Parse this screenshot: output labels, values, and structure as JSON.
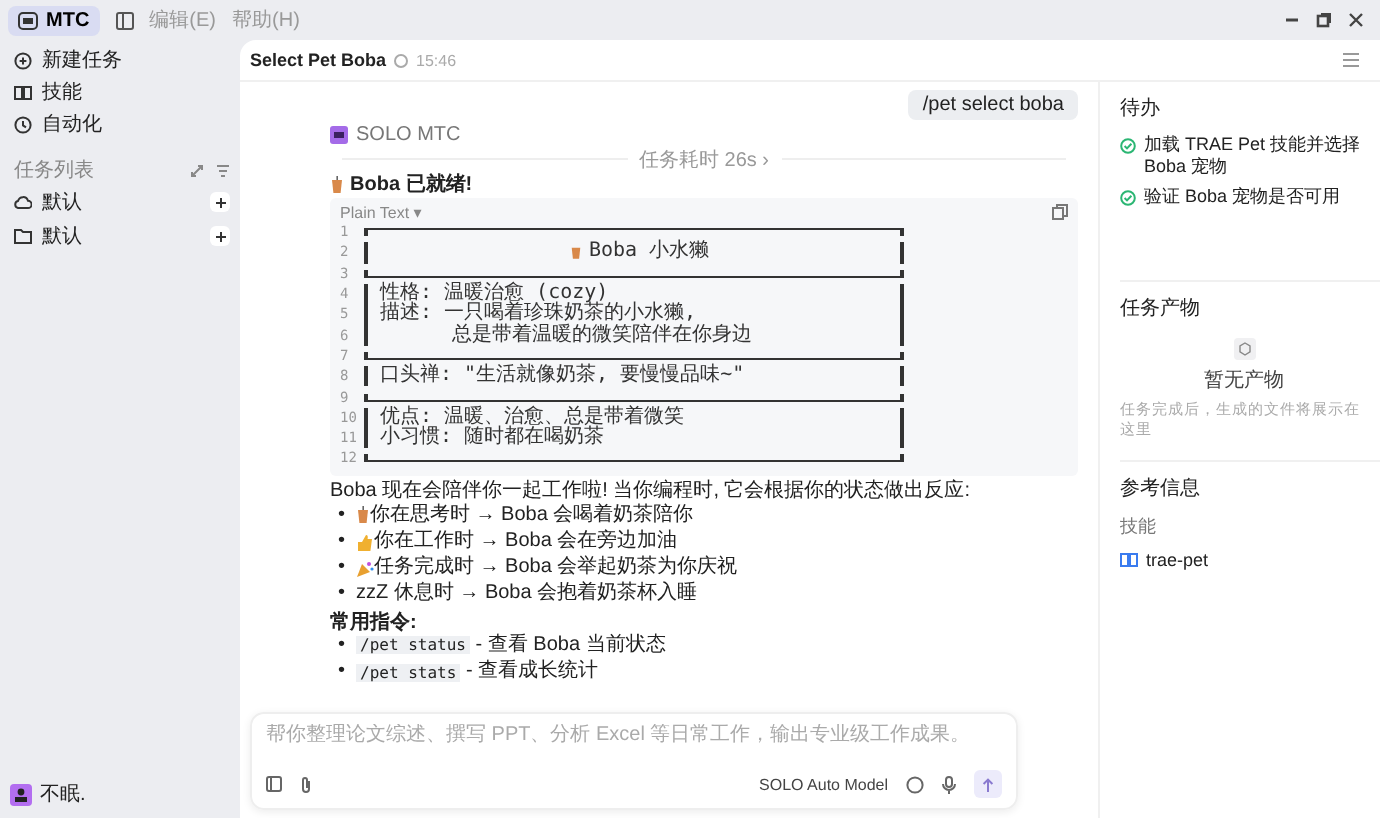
{
  "topbar": {
    "app_button": {
      "label": "MTC",
      "selected": true
    },
    "menus": [
      "编辑(E)",
      "帮助(H)"
    ]
  },
  "sidebar": {
    "items": [
      {
        "kind": "new",
        "label": "新建任务"
      },
      {
        "kind": "skills",
        "label": "技能"
      },
      {
        "kind": "auto",
        "label": "自动化"
      }
    ],
    "section_title": "任务列表",
    "groups": [
      {
        "kind": "cloud",
        "label": "默认"
      },
      {
        "kind": "folder",
        "label": "默认"
      }
    ],
    "user": {
      "name": "不眠."
    }
  },
  "chat": {
    "title": "Select Pet Boba",
    "time": "15:46",
    "user_message": "/pet select boba",
    "agent_name": "SOLO MTC",
    "duration": "任务耗时 26s ›",
    "heading": "Boba 已就绪!",
    "code": {
      "language": "Plain Text ▾",
      "lines": [
        {
          "no": "1",
          "kind": "top"
        },
        {
          "no": "2",
          "kind": "title",
          "text": "Boba 小水獭"
        },
        {
          "no": "3",
          "kind": "mid"
        },
        {
          "no": "4",
          "kind": "text",
          "text": "性格: 温暖治愈 (cozy)"
        },
        {
          "no": "5",
          "kind": "text",
          "text": "描述: 一只喝着珍珠奶茶的小水獭,"
        },
        {
          "no": "6",
          "kind": "text",
          "text": "      总是带着温暖的微笑陪伴在你身边"
        },
        {
          "no": "7",
          "kind": "mid"
        },
        {
          "no": "8",
          "kind": "text",
          "text": "口头禅: \"生活就像奶茶, 要慢慢品味~\""
        },
        {
          "no": "9",
          "kind": "mid"
        },
        {
          "no": "10",
          "kind": "text",
          "text": "优点: 温暖、治愈、总是带着微笑"
        },
        {
          "no": "11",
          "kind": "text",
          "text": "小习惯: 随时都在喝奶茶"
        },
        {
          "no": "12",
          "kind": "bottom"
        }
      ]
    },
    "intro": "Boba 现在会陪伴你一起工作啦! 当你编程时, 它会根据你的状态做出反应:",
    "reactions": [
      {
        "kind": "tea",
        "bullet": "•",
        "text": "你在思考时 → Boba 会喝着奶茶陪你"
      },
      {
        "kind": "thumb",
        "bullet": "•",
        "text": "你在工作时 → Boba 会在旁边加油"
      },
      {
        "kind": "party",
        "bullet": "•",
        "text": "任务完成时 → Boba 会举起奶茶为你庆祝"
      },
      {
        "kind": "plain",
        "bullet": "•",
        "text": "zzZ 休息时 → Boba 会抱着奶茶杯入睡"
      }
    ],
    "commands_title": "常用指令:",
    "commands": [
      {
        "bullet": "•",
        "code": "/pet status",
        "text": " - 查看 Boba 当前状态"
      },
      {
        "bullet": "•",
        "code": "/pet stats",
        "text": " - 查看成长统计"
      }
    ],
    "input": {
      "placeholder": "帮你整理论文综述、撰写 PPT、分析 Excel 等日常工作，输出专业级工作成果。",
      "model": "SOLO Auto Model"
    }
  },
  "panel": {
    "todo_title": "待办",
    "todos": [
      {
        "text": "加载 TRAE Pet 技能并选择 Boba 宠物",
        "checked": true
      },
      {
        "text": "验证 Boba 宠物是否可用",
        "checked": true
      }
    ],
    "output_title": "任务产物",
    "empty_title": "暂无产物",
    "empty_text": "任务完成后，生成的文件将展示在这里",
    "ref_title": "参考信息",
    "ref_label": "技能",
    "skill": "trae-pet"
  }
}
